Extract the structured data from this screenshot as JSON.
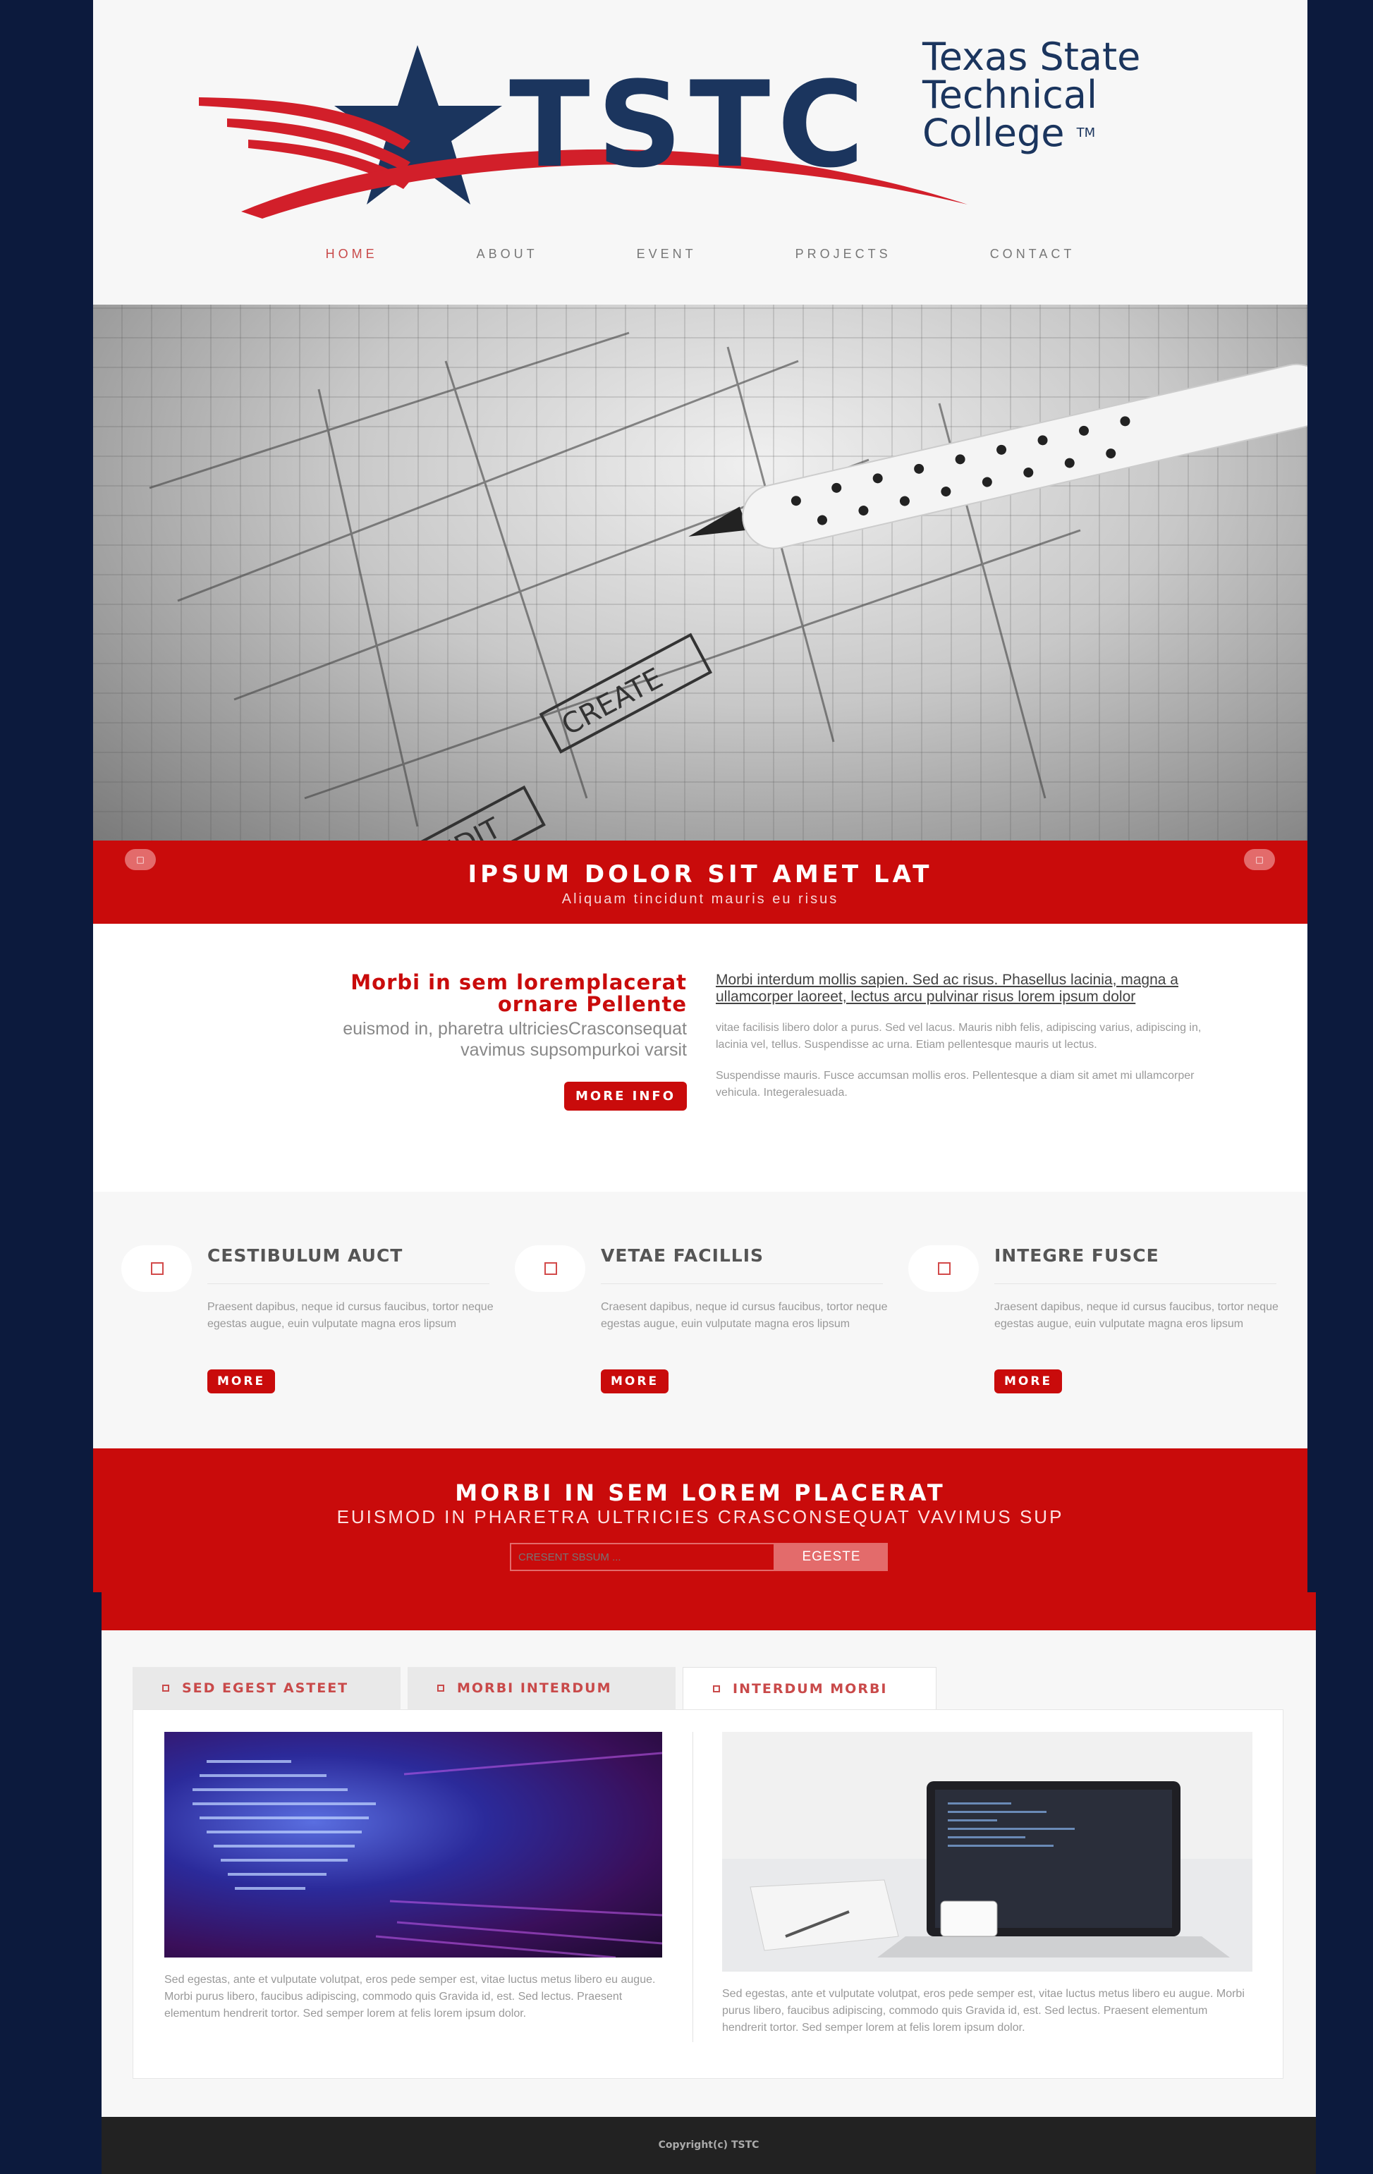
{
  "logo": {
    "line1": "Texas State",
    "line2": "Technical",
    "line3": "College",
    "tm": "TM",
    "brand": "TSTC",
    "colors": {
      "navy": "#1b355e",
      "red": "#d21f2a"
    }
  },
  "nav": [
    "HOME",
    "ABOUT",
    "EVENT",
    "PROJECTS",
    "CONTACT"
  ],
  "hero": {
    "texts": [
      "CREATE",
      "EDIT"
    ]
  },
  "banner": {
    "title": "IPSUM DOLOR SIT AMET LAT",
    "subtitle": "Aliquam tincidunt mauris eu risus",
    "color": "#c90b0b"
  },
  "intro": {
    "heading_line1": "Morbi in sem loremplacerat",
    "heading_line2": "ornare Pellente",
    "sub_line1": "euismod in, pharetra ultriciesCrasconsequat",
    "sub_line2": "vavimus supsompurkoi varsit",
    "button": "MORE INFO",
    "right_heading": "Morbi interdum mollis sapien. Sed ac risus. Phasellus lacinia, magna a ullamcorper laoreet, lectus arcu pulvinar risus lorem ipsum dolor",
    "right_p1": "vitae facilisis libero dolor a purus. Sed vel lacus. Mauris nibh felis, adipiscing varius, adipiscing in, lacinia vel, tellus. Suspendisse ac urna. Etiam pellentesque mauris ut lectus.",
    "right_p2": "Suspendisse mauris. Fusce accumsan mollis eros. Pellentesque a diam sit amet mi ullamcorper vehicula. Integeralesuada."
  },
  "features": [
    {
      "title": "CESTIBULUM AUCT",
      "text": "Praesent dapibus, neque id cursus faucibus, tortor neque egestas augue, euin vulputate magna eros lipsum",
      "button": "MORE"
    },
    {
      "title": "VETAE FACILLIS",
      "text": "Craesent dapibus, neque id cursus faucibus, tortor neque egestas augue, euin vulputate magna eros lipsum",
      "button": "MORE"
    },
    {
      "title": "INTEGRE FUSCE",
      "text": "Jraesent dapibus, neque id cursus faucibus, tortor neque egestas augue, euin vulputate magna eros lipsum",
      "button": "MORE"
    }
  ],
  "cta": {
    "title": "MORBI IN SEM LOREM PLACERAT",
    "subtitle": "EUISMOD IN PHARETRA ULTRICIES CRASCONSEQUAT VAVIMUS SUP",
    "placeholder": "CRESENT SBSUM ...",
    "button": "EGESTE"
  },
  "tabs": [
    "SED EGEST ASTEET",
    "MORBI INTERDUM",
    "INTERDUM MORBI"
  ],
  "panel": {
    "left_text": "Sed egestas, ante et vulputate volutpat, eros pede semper est, vitae luctus metus libero eu augue. Morbi purus libero, faucibus adipiscing, commodo quis Gravida id, est. Sed lectus. Praesent elementum hendrerit tortor. Sed semper lorem at felis lorem ipsum dolor.",
    "right_text": "Sed egestas, ante et vulputate volutpat, eros pede semper est, vitae luctus metus libero eu augue. Morbi purus libero, faucibus adipiscing, commodo quis Gravida id, est. Sed lectus. Praesent elementum hendrerit tortor. Sed semper lorem at felis lorem ipsum dolor."
  },
  "footer": "Copyright(c) TSTC"
}
